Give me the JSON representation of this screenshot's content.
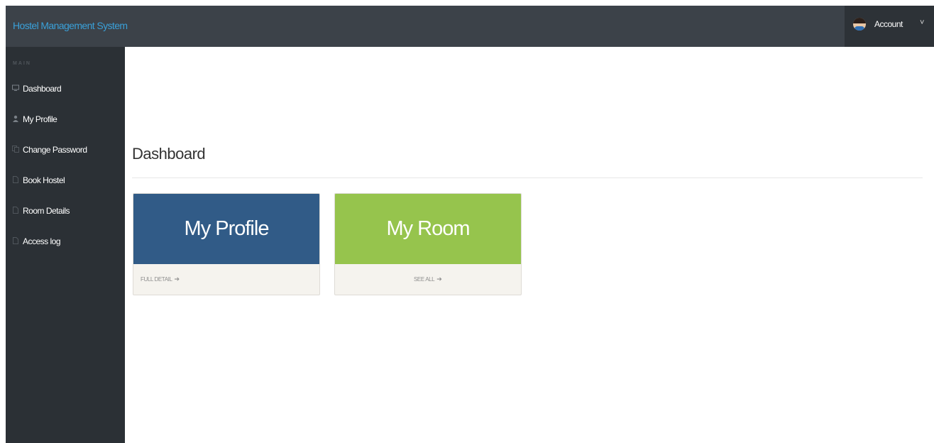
{
  "header": {
    "brand": "Hostel Management System",
    "account_label": "Account",
    "account_caret": "˅"
  },
  "sidebar": {
    "section_label": "MAIN",
    "items": [
      {
        "label": "Dashboard",
        "icon": "monitor-icon"
      },
      {
        "label": "My Profile",
        "icon": "user-icon"
      },
      {
        "label": "Change Password",
        "icon": "copy-icon"
      },
      {
        "label": "Book Hostel",
        "icon": "file-icon"
      },
      {
        "label": "Room Details",
        "icon": "file-icon"
      },
      {
        "label": "Access log",
        "icon": "file-icon"
      }
    ]
  },
  "main": {
    "title": "Dashboard",
    "cards": [
      {
        "title": "My Profile",
        "link": "FULL DETAIL",
        "color": "#315b87"
      },
      {
        "title": "My Room",
        "link": "SEE ALL",
        "color": "#96c44d"
      }
    ]
  },
  "colors": {
    "topbar": "#3c4249",
    "sidebar": "#2b3035",
    "brand": "#3aa0d8"
  }
}
